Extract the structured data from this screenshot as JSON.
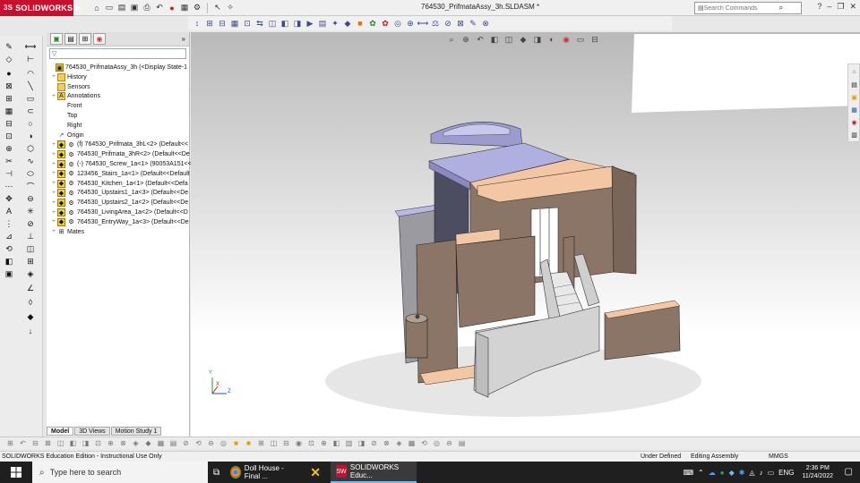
{
  "app": {
    "brand": "SOLIDWORKS",
    "brand_prefix": "3S",
    "document_title": "764530_PrifmataAssy_3h.SLDASM *"
  },
  "search": {
    "placeholder": "Search Commands"
  },
  "feature_manager": {
    "filter_placeholder": "",
    "tree": [
      {
        "label": "764530_PrifmataAssy_3h  (<Display State-1",
        "icon": "assembly-icon",
        "level": 0,
        "expand": ""
      },
      {
        "label": "History",
        "icon": "history-folder-icon",
        "level": 1,
        "expand": "+"
      },
      {
        "label": "Sensors",
        "icon": "sensors-folder-icon",
        "level": 1,
        "expand": ""
      },
      {
        "label": "Annotations",
        "icon": "annotations-icon",
        "level": 1,
        "expand": "+"
      },
      {
        "label": "Front",
        "icon": "plane-icon",
        "level": 1,
        "expand": ""
      },
      {
        "label": "Top",
        "icon": "plane-icon",
        "level": 1,
        "expand": ""
      },
      {
        "label": "Right",
        "icon": "plane-icon",
        "level": 1,
        "expand": ""
      },
      {
        "label": "Origin",
        "icon": "origin-icon",
        "level": 1,
        "expand": ""
      },
      {
        "label": "(f) 764530_Prifmata_3hL<2> (Default<<",
        "icon": "part-icon",
        "level": 1,
        "expand": "+"
      },
      {
        "label": "764530_Prifmata_3hR<2> (Default<<De",
        "icon": "part-icon",
        "level": 1,
        "expand": "+"
      },
      {
        "label": "(-) 764530_Screw_1a<1> (90053A151<<",
        "icon": "part-icon",
        "level": 1,
        "expand": "+"
      },
      {
        "label": "123456_Stairs_1a<1> (Default<<Default",
        "icon": "part-icon",
        "level": 1,
        "expand": "+"
      },
      {
        "label": "764530_Kitchen_1a<1> (Default<<Defa",
        "icon": "part-icon",
        "level": 1,
        "expand": "+"
      },
      {
        "label": "764530_Upstairs1_1a<3> (Default<<De",
        "icon": "part-icon",
        "level": 1,
        "expand": "+"
      },
      {
        "label": "764530_Upstairs2_1a<2> (Default<<De",
        "icon": "part-icon",
        "level": 1,
        "expand": "+"
      },
      {
        "label": "764530_LivingArea_1a<2> (Default<<D",
        "icon": "part-icon",
        "level": 1,
        "expand": "+"
      },
      {
        "label": "764530_EntryWay_1a<3> (Default<<De",
        "icon": "part-icon",
        "level": 1,
        "expand": "+"
      },
      {
        "label": "Mates",
        "icon": "mates-icon",
        "level": 1,
        "expand": "+"
      }
    ]
  },
  "bottom_tabs": [
    "Model",
    "3D Views",
    "Motion Study 1"
  ],
  "triad": {
    "x": "X",
    "y": "Y",
    "z": "Z"
  },
  "status": {
    "edition": "SOLIDWORKS Education Edition - Instructional Use Only",
    "defined": "Under Defined",
    "mode": "Editing Assembly",
    "units": "MMGS"
  },
  "taskbar": {
    "search_placeholder": "Type here to search",
    "apps": [
      {
        "label": "Doll House - Final ...",
        "icon": "chrome-icon"
      },
      {
        "label": "",
        "icon": "x-app-icon"
      },
      {
        "label": "SOLIDWORKS Educ...",
        "icon": "solidworks-icon"
      }
    ],
    "language": "ENG",
    "time": "2:36 PM",
    "date": "11/24/2022"
  },
  "colors": {
    "brand_red": "#c8102e",
    "wall_brown": "#8b7566",
    "roof_lavender": "#a9a9d8",
    "stair_gray": "#d7d7d7",
    "floor_peach": "#f4c7a4"
  }
}
